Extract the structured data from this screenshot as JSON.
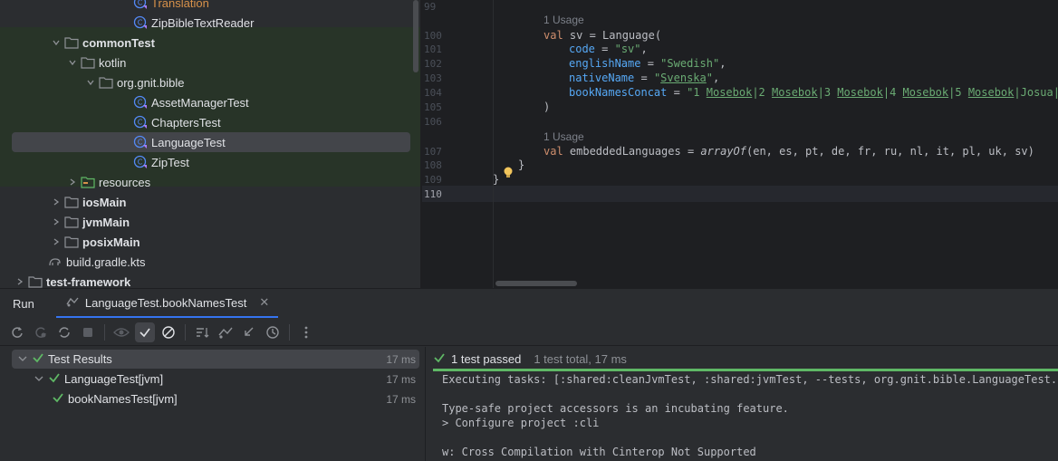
{
  "project_tree": {
    "rows": [
      {
        "label": "Translation",
        "indent": 148,
        "icon": "kotlin-class-icon",
        "style": "orange",
        "chevron": ""
      },
      {
        "label": "ZipBibleTextReader",
        "indent": 148,
        "icon": "kotlin-class-icon",
        "style": "",
        "chevron": ""
      },
      {
        "label": "commonTest",
        "indent": 72,
        "icon": "folder-icon",
        "style": "bold",
        "chevron": "v"
      },
      {
        "label": "kotlin",
        "indent": 90,
        "icon": "folder-icon",
        "style": "",
        "chevron": "v"
      },
      {
        "label": "org.gnit.bible",
        "indent": 110,
        "icon": "folder-icon",
        "style": "",
        "chevron": "v"
      },
      {
        "label": "AssetManagerTest",
        "indent": 148,
        "icon": "kotlin-class-icon",
        "style": "",
        "chevron": ""
      },
      {
        "label": "ChaptersTest",
        "indent": 148,
        "icon": "kotlin-class-icon",
        "style": "",
        "chevron": ""
      },
      {
        "label": "LanguageTest",
        "indent": 148,
        "icon": "kotlin-class-icon",
        "style": "",
        "chevron": "",
        "selected": true
      },
      {
        "label": "ZipTest",
        "indent": 148,
        "icon": "kotlin-class-icon",
        "style": "",
        "chevron": ""
      },
      {
        "label": "resources",
        "indent": 90,
        "icon": "resources-folder-icon",
        "style": "",
        "chevron": ">"
      },
      {
        "label": "iosMain",
        "indent": 72,
        "icon": "folder-icon",
        "style": "bold",
        "chevron": ">"
      },
      {
        "label": "jvmMain",
        "indent": 72,
        "icon": "folder-icon",
        "style": "bold",
        "chevron": ">"
      },
      {
        "label": "posixMain",
        "indent": 72,
        "icon": "folder-icon",
        "style": "bold",
        "chevron": ">"
      },
      {
        "label": "build.gradle.kts",
        "indent": 54,
        "icon": "gradle-icon",
        "style": "",
        "chevron": ""
      },
      {
        "label": "test-framework",
        "indent": 32,
        "icon": "folder-icon",
        "style": "bold",
        "chevron": ">"
      }
    ]
  },
  "editor": {
    "line_numbers": [
      "99",
      "100",
      "101",
      "102",
      "103",
      "104",
      "105",
      "106",
      "107",
      "108",
      "109",
      "110"
    ],
    "usage_label": "1 Usage",
    "code": {
      "l100_a": "val ",
      "l100_b": "sv",
      "l100_c": " = Language(",
      "l101_a": "code",
      "l101_b": " = ",
      "l101_c": "\"sv\"",
      "l101_d": ",",
      "l102_a": "englishName",
      "l102_b": " = ",
      "l102_c": "\"Swedish\"",
      "l102_d": ",",
      "l103_a": "nativeName",
      "l103_b": " = ",
      "l103_c": "\"",
      "l103_d": "Svenska",
      "l103_e": "\"",
      "l103_f": ",",
      "l104_a": "bookNamesConcat",
      "l104_b": " = ",
      "l104_c": "\"1 ",
      "l104_d": "Mosebok",
      "l104_e": "|2 ",
      "l104_f": "Mosebok",
      "l104_g": "|3 ",
      "l104_h": "Mosebok",
      "l104_i": "|4 ",
      "l104_j": "Mosebok",
      "l104_k": "|5 ",
      "l104_l": "Mosebok",
      "l104_m": "|Josua|",
      "l104_n": "Do",
      "l105": ")",
      "l107_a": "val ",
      "l107_b": "embeddedLanguages",
      "l107_c": " = ",
      "l107_d": "arrayOf",
      "l107_e": "(en, es, pt, de, fr, ru, nl, it, pl, uk, sv)",
      "l108": "}",
      "l109": "}"
    }
  },
  "run_window": {
    "tab_run": "Run",
    "tab_test": "LanguageTest.bookNamesTest",
    "results": [
      {
        "label": "Test Results",
        "duration": "17 ms",
        "indent": 6
      },
      {
        "label": "LanguageTest[jvm]",
        "duration": "17 ms",
        "indent": 24
      },
      {
        "label": "bookNamesTest[jvm]",
        "duration": "17 ms",
        "indent": 44
      }
    ],
    "status_passed": "1 test passed",
    "status_total": "1 test total, 17 ms",
    "console_lines": [
      "Executing tasks: [:shared:cleanJvmTest, :shared:jvmTest, --tests, org.gnit.bible.LanguageTest.boo",
      "",
      "Type-safe project accessors is an incubating feature.",
      "> Configure project :cli",
      "",
      "w: Cross Compilation with Cinterop Not Supported"
    ]
  },
  "colors": {
    "accent": "#3574f0",
    "pass_green": "#5fb865",
    "keyword": "#cf8e6d",
    "string": "#6aab73",
    "param": "#56a8f5"
  }
}
